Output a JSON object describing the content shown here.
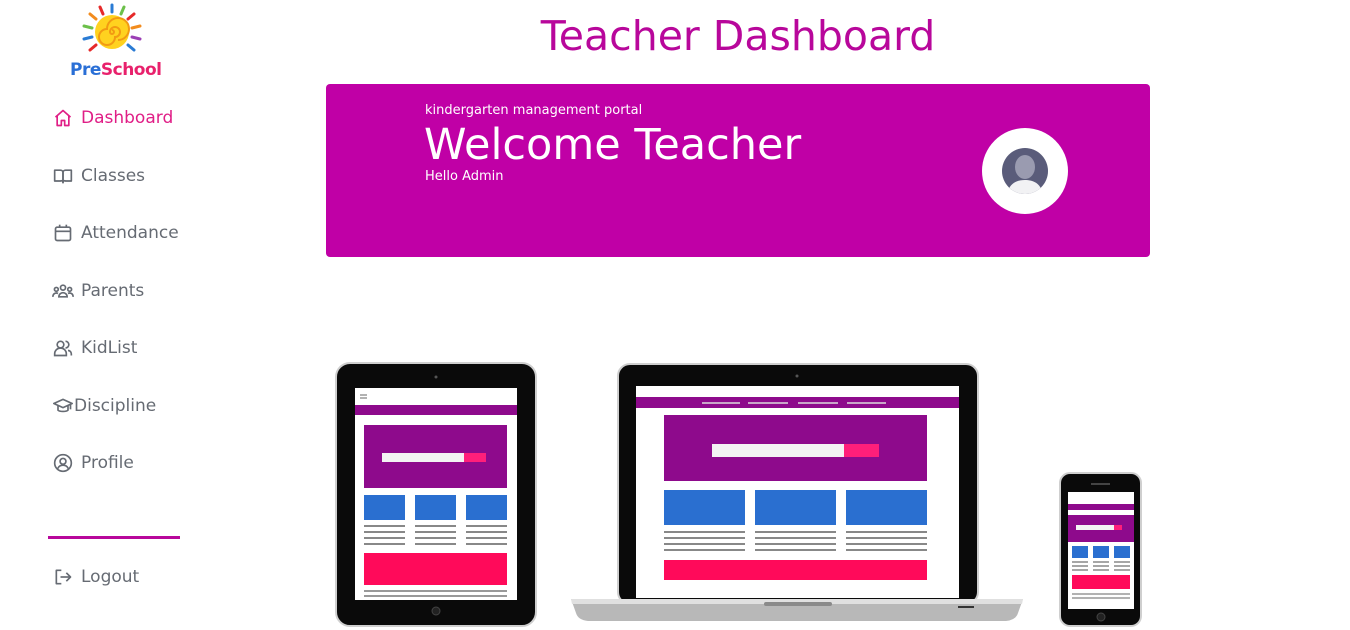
{
  "logo": {
    "text_pre": "Pre",
    "text_school": "School"
  },
  "sidebar": {
    "items": [
      {
        "label": "Dashboard",
        "icon": "home-icon",
        "active": true
      },
      {
        "label": "Classes",
        "icon": "book-icon",
        "active": false
      },
      {
        "label": "Attendance",
        "icon": "calendar-icon",
        "active": false
      },
      {
        "label": "Parents",
        "icon": "people-icon",
        "active": false
      },
      {
        "label": "KidList",
        "icon": "users-icon",
        "active": false
      },
      {
        "label": "Discipline",
        "icon": "graduation-cap-icon",
        "active": false
      },
      {
        "label": "Profile",
        "icon": "user-circle-icon",
        "active": false
      }
    ],
    "logout": {
      "label": "Logout",
      "icon": "logout-icon"
    }
  },
  "header": {
    "title": "Teacher Dashboard"
  },
  "banner": {
    "subtitle": "kindergarten management portal",
    "title": "Welcome Teacher",
    "greeting": "Hello Admin"
  },
  "colors": {
    "brand": "#b8079b",
    "banner": "#c000a6",
    "active_nav": "#e01e86",
    "nav_text": "#666b73"
  }
}
